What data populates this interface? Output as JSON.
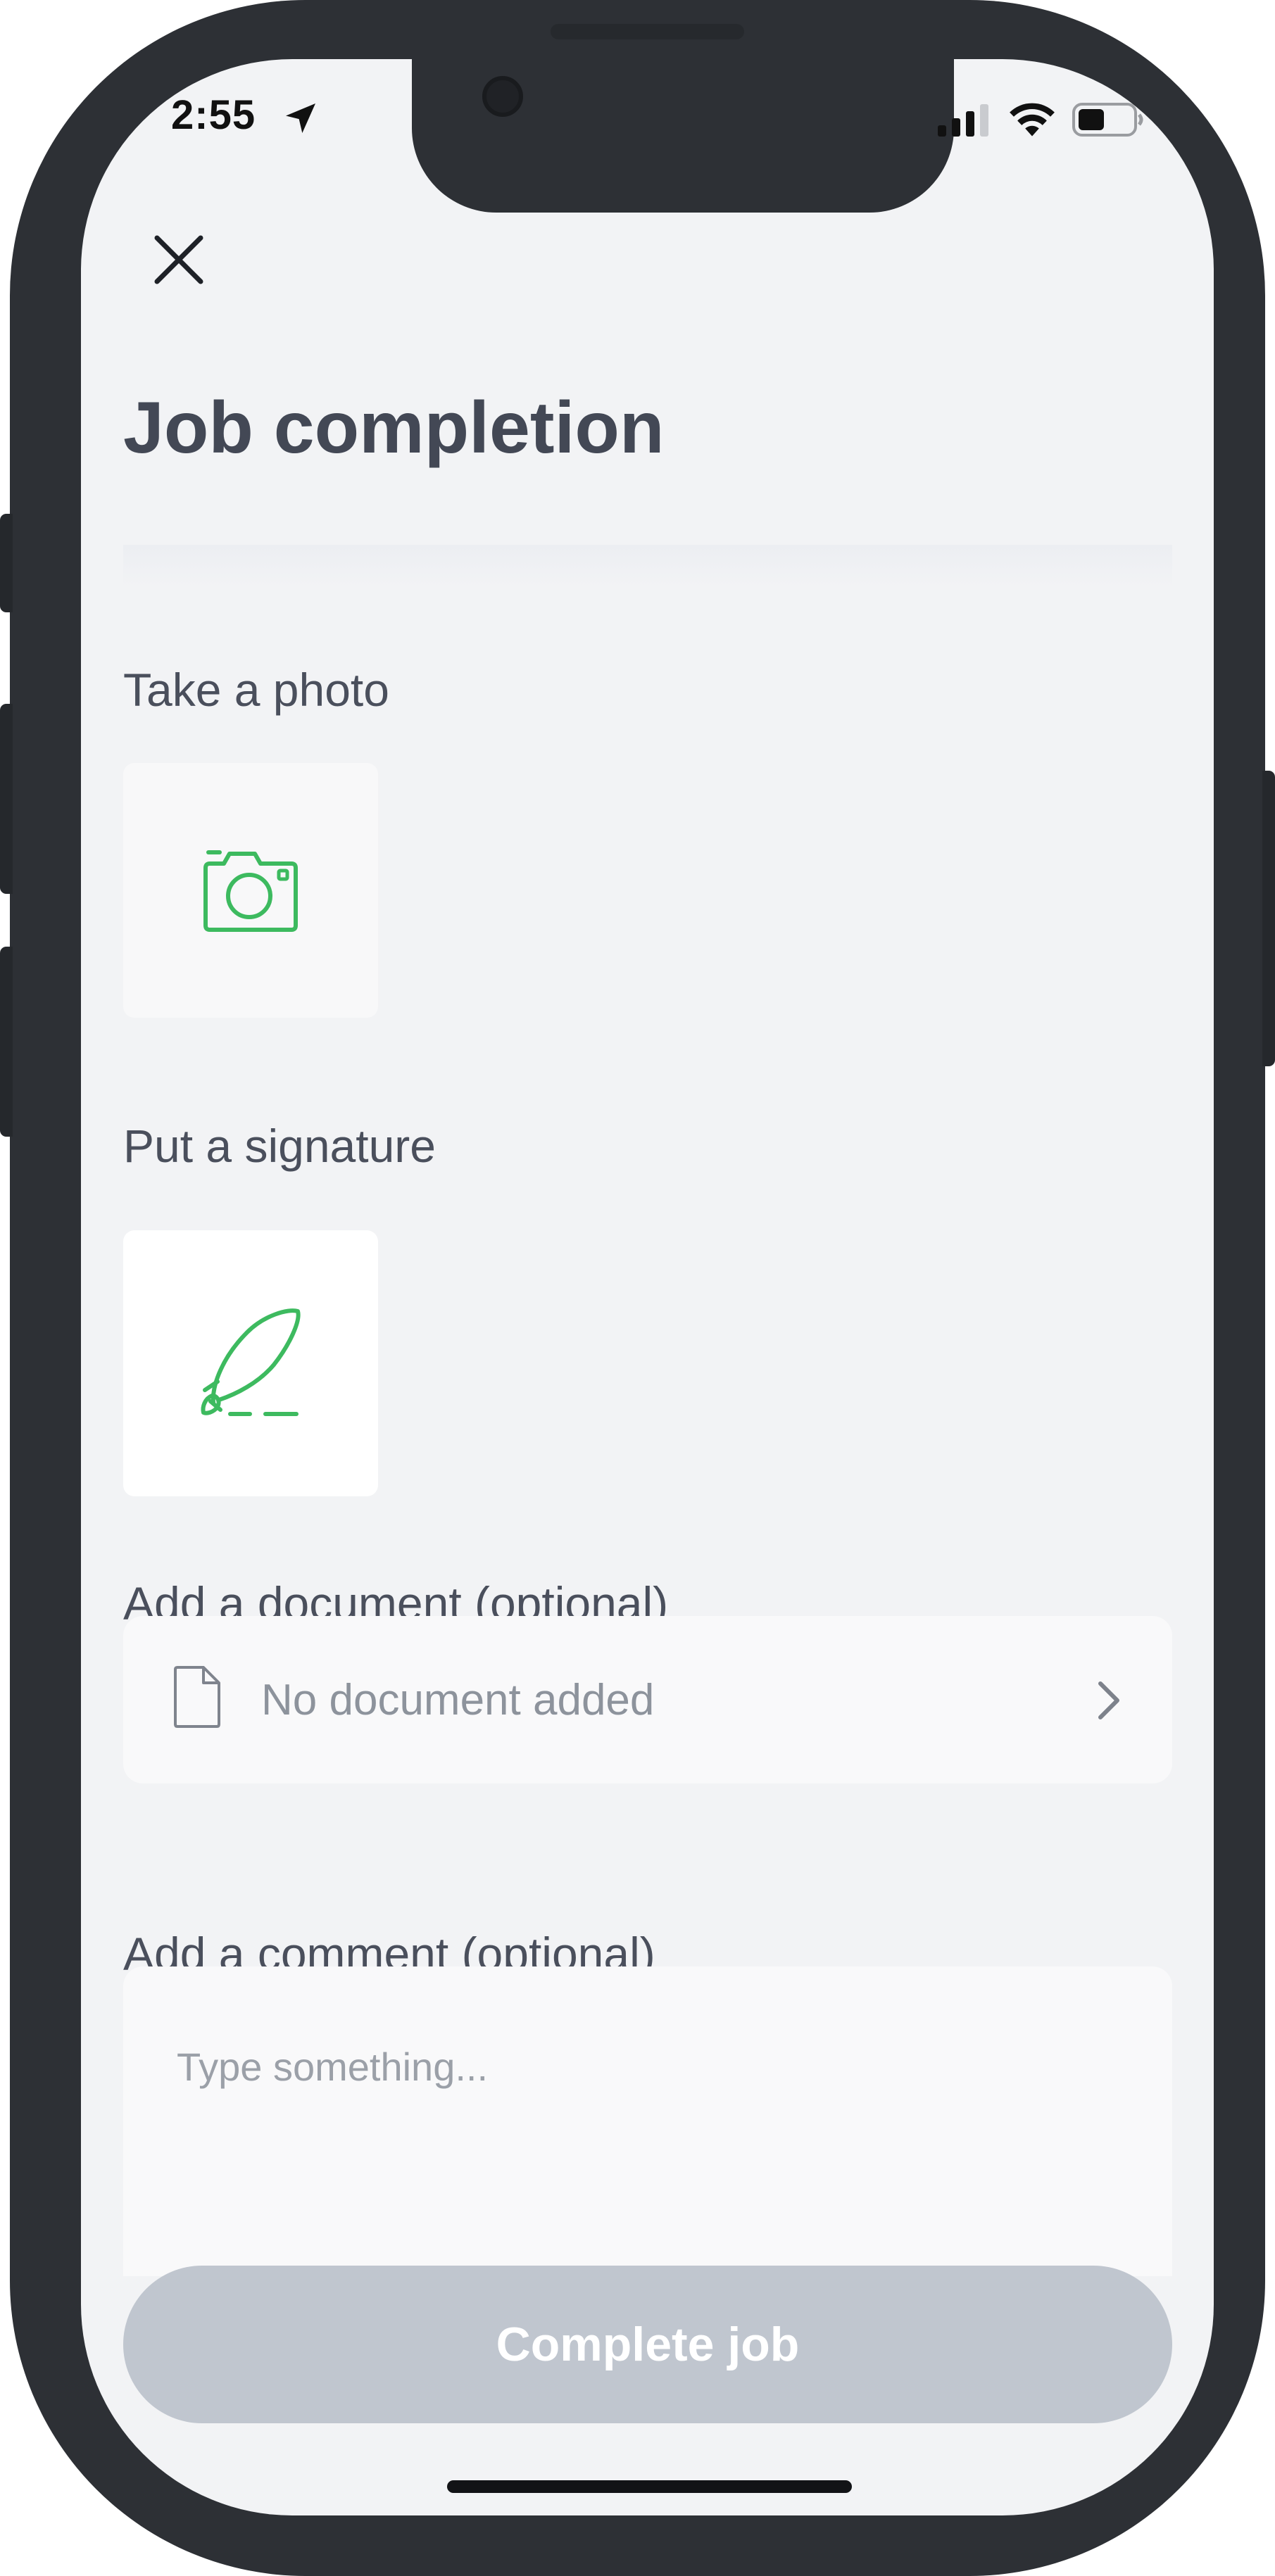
{
  "status_bar": {
    "time": "2:55",
    "location_icon": "location-arrow-icon",
    "signal_icon": "cellular-signal-icon",
    "wifi_icon": "wifi-icon",
    "battery_icon": "battery-icon"
  },
  "header": {
    "close_icon": "close-icon",
    "title": "Job completion"
  },
  "photo": {
    "label": "Take a photo",
    "icon": "camera-icon"
  },
  "signature": {
    "label": "Put a signature",
    "icon": "quill-signature-icon"
  },
  "document": {
    "label": "Add a document (optional)",
    "placeholder": "No document added",
    "icon": "document-icon",
    "chevron_icon": "chevron-right-icon"
  },
  "comment": {
    "label": "Add a comment (optional)",
    "placeholder": "Type something..."
  },
  "actions": {
    "complete_label": "Complete job"
  },
  "colors": {
    "accent_green": "#3dba5f",
    "screen_bg": "#f2f3f5",
    "title_text": "#434855",
    "button_disabled": "#c0c6cf",
    "frame": "#2d3035"
  }
}
